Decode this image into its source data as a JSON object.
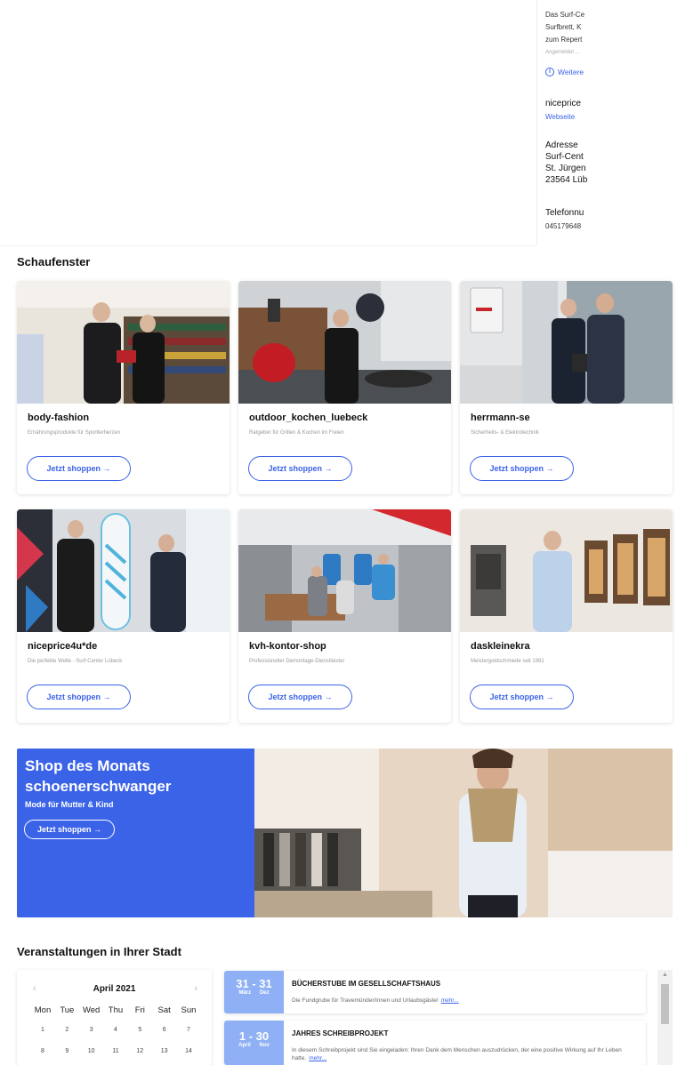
{
  "info_panel": {
    "description_lines": [
      "Das Surf-Ce",
      "Surfbrett, K",
      "zum Repert"
    ],
    "meta": "Angemeldet ...",
    "more_link": "Weitere",
    "shop_name": "niceprice",
    "website_link": "Webseite",
    "address_label": "Adresse",
    "address_lines": [
      "Surf-Cent",
      "St. Jürgen",
      "23564 Lüb"
    ],
    "phone_label": "Telefonnu",
    "phone": "045179648"
  },
  "schaufenster": {
    "title": "Schaufenster",
    "shops": [
      {
        "name": "body-fashion",
        "tagline": "Ernährungsprodukte für Sportlerherzen",
        "button": "Jetzt shoppen →"
      },
      {
        "name": "outdoor_kochen_luebeck",
        "tagline": "Ratgeber für Grillen & Kochen im Freien",
        "button": "Jetzt shoppen →"
      },
      {
        "name": "herrmann-se",
        "tagline": "Sicherheits- & Elektrotechnik",
        "button": "Jetzt shoppen →"
      },
      {
        "name": "niceprice4u*de",
        "tagline": "Die perfekte Welle - Surf-Center Lübeck",
        "button": "Jetzt shoppen →"
      },
      {
        "name": "kvh-kontor-shop",
        "tagline": "Professioneller Demontage-Dienstleister",
        "button": "Jetzt shoppen →"
      },
      {
        "name": "daskleinekra",
        "tagline": "Meistergoldschmiede seit 1991",
        "button": "Jetzt shoppen →"
      }
    ]
  },
  "shop_des_monats": {
    "title_line1": "Shop des Monats",
    "title_line2": "schoenerschwanger",
    "subtitle": "Mode für Mutter & Kind",
    "button": "Jetzt shoppen →"
  },
  "events": {
    "title": "Veranstaltungen in Ihrer Stadt",
    "calendar": {
      "prev": "‹",
      "next": "›",
      "month": "April 2021",
      "weekdays": [
        "Mon",
        "Tue",
        "Wed",
        "Thu",
        "Fri",
        "Sat",
        "Sun"
      ],
      "week1": [
        "1",
        "2",
        "3",
        "4",
        "5",
        "6",
        "7"
      ],
      "week2": [
        "8",
        "9",
        "10",
        "11",
        "12",
        "13",
        "14"
      ]
    },
    "items": [
      {
        "range": "31 - 31",
        "months": "März Dez",
        "title": "BÜCHERSTUBE IM GESELLSCHAFTSHAUS",
        "text": "Die Fundgrube für Travemünder/innen und Urlaubsgäste!",
        "more": "mehr..."
      },
      {
        "range": "1 - 30",
        "months": "April Nov",
        "title": "JAHRES SCHREIBPROJEKT",
        "text": "In diesem Schreibprojekt sind Sie eingeladen: Ihren Dank dem Menschen auszudrücken, der eine positive Wirkung auf Ihr Leben hatte.",
        "more": "mehr..."
      }
    ],
    "scroll_up": "▲"
  },
  "colors": {
    "accent": "#3b63e8",
    "event_date_bg": "#8fb0f4"
  }
}
